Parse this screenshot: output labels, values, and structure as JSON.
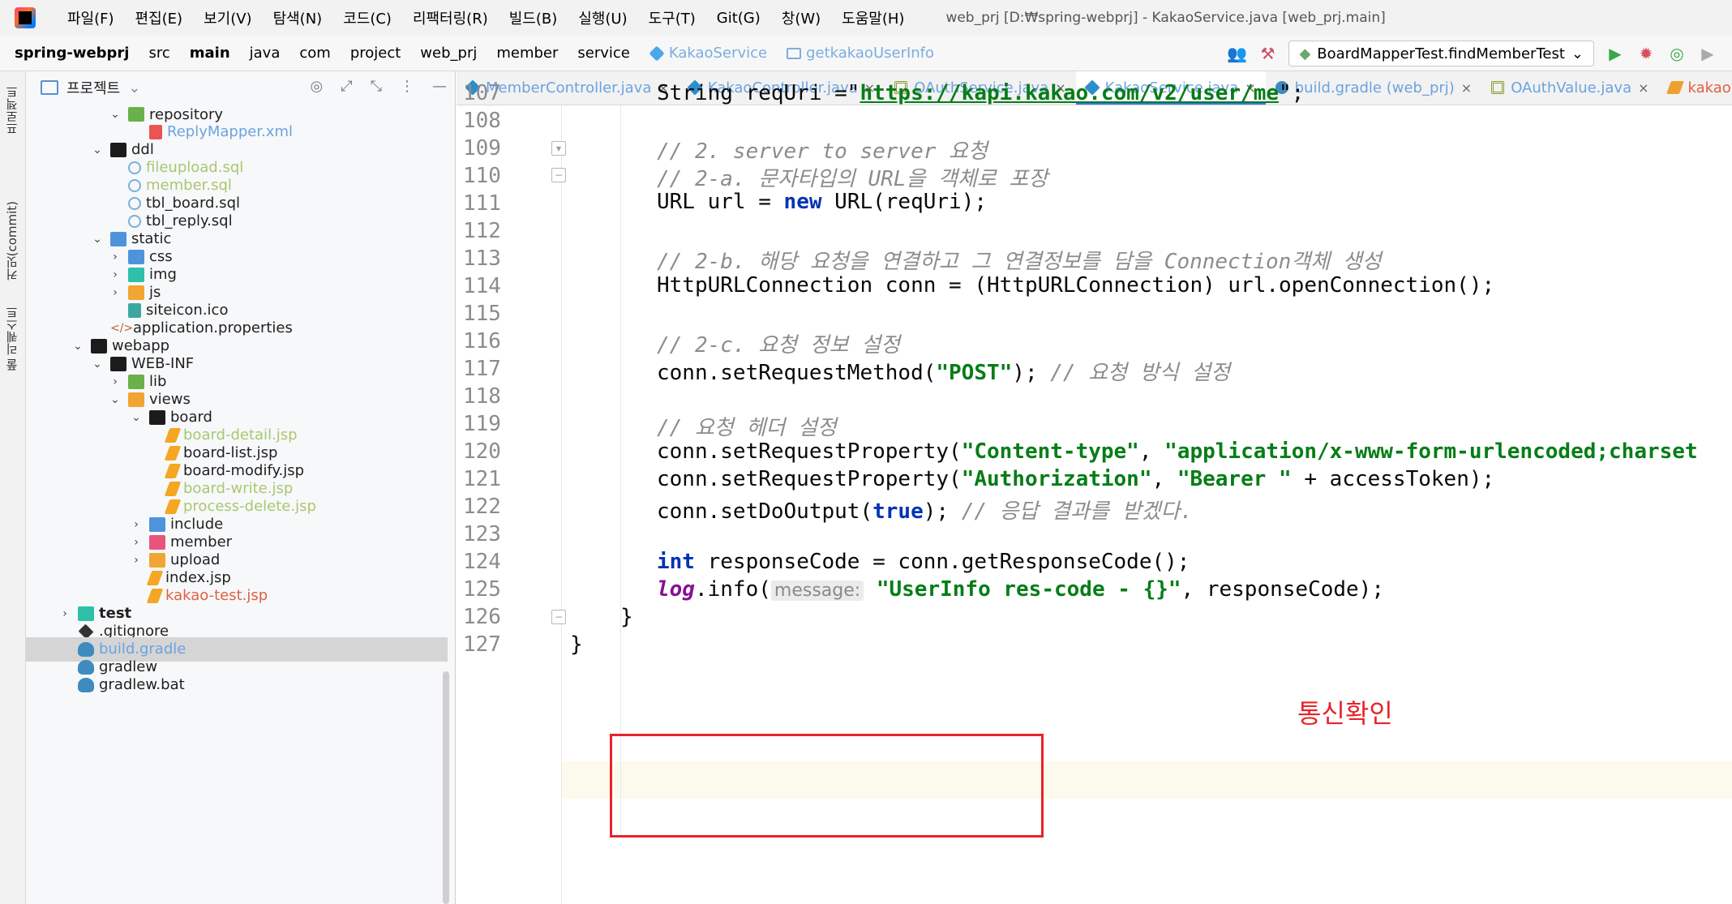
{
  "menubar": {
    "items": [
      "파일(F)",
      "편집(E)",
      "보기(V)",
      "탐색(N)",
      "코드(C)",
      "리팩터링(R)",
      "빌드(B)",
      "실행(U)",
      "도구(T)",
      "Git(G)",
      "창(W)",
      "도움말(H)"
    ],
    "window_title": "web_prj [D:₩spring-webprj] - KakaoService.java [web_prj.main]"
  },
  "navbar": {
    "crumbs": [
      "spring-webprj",
      "src",
      "main",
      "java",
      "com",
      "project",
      "web_prj",
      "member",
      "service",
      "KakaoService",
      "getkakaoUserInfo"
    ],
    "run_config": "BoardMapperTest.findMemberTest"
  },
  "toolstrip": {
    "project": "프로젝트",
    "commit": "커밋(commit)",
    "pull_requests": "풀 리퀘스트"
  },
  "project_panel": {
    "title": "프로젝트",
    "tree": [
      {
        "label": "repository",
        "depth": 2,
        "arrow": "v",
        "icon": "folder-green",
        "style": ""
      },
      {
        "label": "ReplyMapper.xml",
        "depth": 3,
        "arrow": "",
        "icon": "file-xml",
        "style": "blue"
      },
      {
        "label": "ddl",
        "depth": 1,
        "arrow": "v",
        "icon": "folder",
        "style": ""
      },
      {
        "label": "fileupload.sql",
        "depth": 2,
        "arrow": "",
        "icon": "file-sql",
        "style": "dim"
      },
      {
        "label": "member.sql",
        "depth": 2,
        "arrow": "",
        "icon": "file-sql",
        "style": "dim"
      },
      {
        "label": "tbl_board.sql",
        "depth": 2,
        "arrow": "",
        "icon": "file-sql",
        "style": ""
      },
      {
        "label": "tbl_reply.sql",
        "depth": 2,
        "arrow": "",
        "icon": "file-sql",
        "style": ""
      },
      {
        "label": "static",
        "depth": 1,
        "arrow": "v",
        "icon": "folder-blue",
        "style": ""
      },
      {
        "label": "css",
        "depth": 2,
        "arrow": ">",
        "icon": "folder-blue",
        "style": ""
      },
      {
        "label": "img",
        "depth": 2,
        "arrow": ">",
        "icon": "folder-teal",
        "style": ""
      },
      {
        "label": "js",
        "depth": 2,
        "arrow": ">",
        "icon": "folder-orange",
        "style": ""
      },
      {
        "label": "siteicon.ico",
        "depth": 2,
        "arrow": "",
        "icon": "file-img",
        "style": ""
      },
      {
        "label": "application.properties",
        "depth": 1,
        "arrow": "",
        "icon": "file-prop",
        "style": ""
      },
      {
        "label": "webapp",
        "depth": 0,
        "arrow": "v",
        "icon": "folder",
        "style": ""
      },
      {
        "label": "WEB-INF",
        "depth": 1,
        "arrow": "v",
        "icon": "folder",
        "style": ""
      },
      {
        "label": "lib",
        "depth": 2,
        "arrow": ">",
        "icon": "folder-green",
        "style": ""
      },
      {
        "label": "views",
        "depth": 2,
        "arrow": "v",
        "icon": "folder-orange",
        "style": ""
      },
      {
        "label": "board",
        "depth": 3,
        "arrow": "v",
        "icon": "folder",
        "style": ""
      },
      {
        "label": "board-detail.jsp",
        "depth": 4,
        "arrow": "",
        "icon": "file-jsp",
        "style": "dim"
      },
      {
        "label": "board-list.jsp",
        "depth": 4,
        "arrow": "",
        "icon": "file-jsp",
        "style": ""
      },
      {
        "label": "board-modify.jsp",
        "depth": 4,
        "arrow": "",
        "icon": "file-jsp",
        "style": ""
      },
      {
        "label": "board-write.jsp",
        "depth": 4,
        "arrow": "",
        "icon": "file-jsp",
        "style": "dim"
      },
      {
        "label": "process-delete.jsp",
        "depth": 4,
        "arrow": "",
        "icon": "file-jsp",
        "style": "dim"
      },
      {
        "label": "include",
        "depth": 3,
        "arrow": ">",
        "icon": "folder-blue",
        "style": ""
      },
      {
        "label": "member",
        "depth": 3,
        "arrow": ">",
        "icon": "folder-red",
        "style": ""
      },
      {
        "label": "upload",
        "depth": 3,
        "arrow": ">",
        "icon": "folder-orange",
        "style": ""
      },
      {
        "label": "index.jsp",
        "depth": 3,
        "arrow": "",
        "icon": "file-jsp",
        "style": ""
      },
      {
        "label": "kakao-test.jsp",
        "depth": 3,
        "arrow": "",
        "icon": "file-jsp",
        "style": "red"
      },
      {
        "label": "test",
        "depth": -1,
        "arrow": ">",
        "icon": "folder-teal",
        "style": "bold"
      },
      {
        "label": ".gitignore",
        "depth": -1,
        "arrow": "",
        "icon": "file-git",
        "style": ""
      },
      {
        "label": "build.gradle",
        "depth": -1,
        "arrow": "",
        "icon": "file-gradle",
        "style": "selected"
      },
      {
        "label": "gradlew",
        "depth": -1,
        "arrow": "",
        "icon": "file-gradle",
        "style": ""
      },
      {
        "label": "gradlew.bat",
        "depth": -1,
        "arrow": "",
        "icon": "file-gradle",
        "style": ""
      }
    ]
  },
  "tabs": [
    {
      "label": "MemberController.java",
      "icon": "java",
      "style": "blue"
    },
    {
      "label": "KakaoController.java",
      "icon": "java",
      "style": "blue"
    },
    {
      "label": "OAuthService.java",
      "icon": "grid",
      "style": "blue"
    },
    {
      "label": "KakaoService.java",
      "icon": "java",
      "style": "blue",
      "active": true
    },
    {
      "label": "build.gradle (web_prj)",
      "icon": "gradle",
      "style": "blue"
    },
    {
      "label": "OAuthValue.java",
      "icon": "grid",
      "style": "blue"
    },
    {
      "label": "kakao-test.jsp",
      "icon": "orange",
      "style": "red"
    }
  ],
  "editor": {
    "line_numbers": [
      "107",
      "108",
      "109",
      "110",
      "111",
      "112",
      "113",
      "114",
      "115",
      "116",
      "117",
      "118",
      "119",
      "120",
      "121",
      "122",
      "123",
      "124",
      "125",
      "126",
      "127"
    ],
    "current_line": "125",
    "code": {
      "l107": {
        "a": "String reqUri =\"",
        "url": "https://kapi.kakao.com/v2/user/me",
        "b": "\";"
      },
      "l109": "// 2. server to server 요청",
      "l110": "// 2-a. 문자타입의 URL을 객체로 포장",
      "l111": {
        "a": "URL url = ",
        "kw": "new",
        "b": " URL(reqUri);"
      },
      "l113": "// 2-b. 해당 요청을 연결하고 그 연결정보를 담을 Connection객체 생성",
      "l114": "HttpURLConnection conn = (HttpURLConnection) url.openConnection();",
      "l116": "// 2-c. 요청 정보 설정",
      "l117": {
        "a": "conn.setRequestMethod(",
        "str": "\"POST\"",
        "b": "); ",
        "cmt": "// 요청 방식 설정"
      },
      "l119": "// 요청 헤더 설정",
      "l120": {
        "a": "conn.setRequestProperty(",
        "s1": "\"Content-type\"",
        "b": ", ",
        "s2": "\"application/x-www-form-urlencoded;charset"
      },
      "l121": {
        "a": "conn.setRequestProperty(",
        "s1": "\"Authorization\"",
        "b": ", ",
        "s2": "\"Bearer \"",
        "c": " + accessToken);"
      },
      "l122": {
        "a": "conn.setDoOutput(",
        "kw": "true",
        "b": "); ",
        "cmt": "// 응답 결과를 받겠다."
      },
      "l124": {
        "kw": "int",
        "a": " responseCode = conn.getResponseCode();"
      },
      "l125": {
        "field": "log",
        "a": ".info(",
        "hint": "message:",
        "str": "\"UserInfo res-code - {}\"",
        "b": ", responseCode);"
      },
      "l126": "}",
      "l127": "}"
    },
    "annotation": "통신확인"
  }
}
